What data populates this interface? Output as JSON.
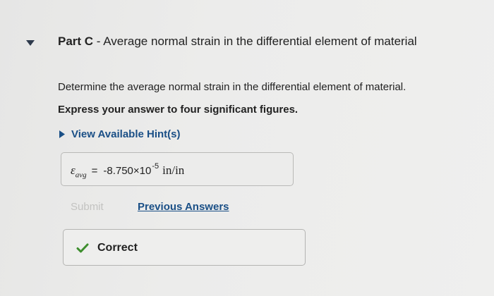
{
  "part": {
    "label": "Part C",
    "separator": " - ",
    "title": "Average normal strain in the differential element of material"
  },
  "question": "Determine the average normal strain in the differential element of material.",
  "instruction": "Express your answer to four significant figures.",
  "hints": {
    "label": "View Available Hint(s)",
    "icon": "triangle-right-icon"
  },
  "answer": {
    "symbol": "ε",
    "subscript": "avg",
    "equals": "=",
    "mantissa": "-8.750×10",
    "exponent": "-5",
    "units": "in/in"
  },
  "actions": {
    "submit_label": "Submit",
    "previous_answers_label": "Previous Answers"
  },
  "feedback": {
    "text": "Correct",
    "icon": "checkmark-icon"
  },
  "colors": {
    "link": "#1a4f86",
    "check": "#3e8e2e",
    "disabled": "#c3c3c1"
  }
}
